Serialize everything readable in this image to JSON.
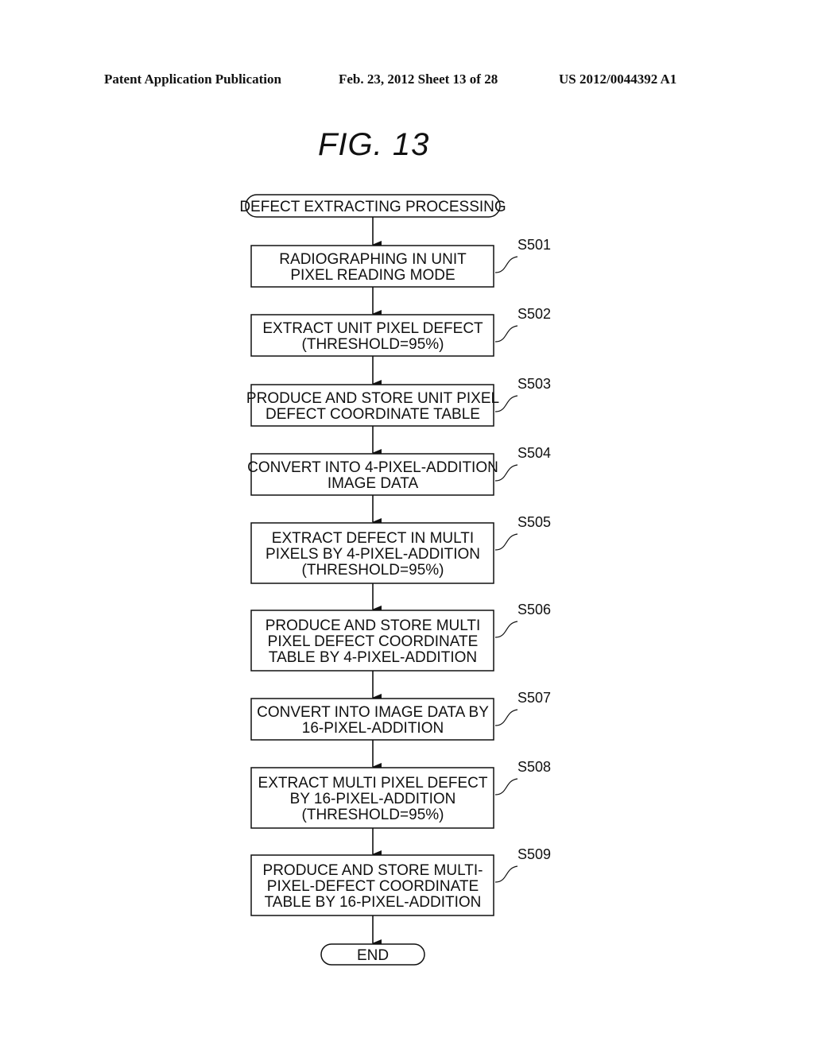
{
  "header": {
    "left": "Patent Application Publication",
    "middle": "Feb. 23, 2012   Sheet 13 of 28",
    "right": "US 2012/0044392 A1"
  },
  "figure": {
    "title": "FIG.  13"
  },
  "flowchart": {
    "start": "DEFECT EXTRACTING PROCESSING",
    "end": "END",
    "steps": [
      {
        "id": "S501",
        "lines": [
          "RADIOGRAPHING IN UNIT",
          "PIXEL READING MODE"
        ]
      },
      {
        "id": "S502",
        "lines": [
          "EXTRACT UNIT PIXEL DEFECT",
          "(THRESHOLD=95%)"
        ]
      },
      {
        "id": "S503",
        "lines": [
          "PRODUCE AND STORE UNIT PIXEL",
          "DEFECT COORDINATE TABLE"
        ]
      },
      {
        "id": "S504",
        "lines": [
          "CONVERT INTO 4-PIXEL-ADDITION",
          "IMAGE DATA"
        ]
      },
      {
        "id": "S505",
        "lines": [
          "EXTRACT DEFECT IN MULTI",
          "PIXELS BY 4-PIXEL-ADDITION",
          "(THRESHOLD=95%)"
        ]
      },
      {
        "id": "S506",
        "lines": [
          "PRODUCE AND STORE MULTI",
          "PIXEL DEFECT COORDINATE",
          "TABLE BY 4-PIXEL-ADDITION"
        ]
      },
      {
        "id": "S507",
        "lines": [
          "CONVERT INTO IMAGE DATA BY",
          "16-PIXEL-ADDITION"
        ]
      },
      {
        "id": "S508",
        "lines": [
          "EXTRACT MULTI PIXEL DEFECT",
          "BY 16-PIXEL-ADDITION",
          "(THRESHOLD=95%)"
        ]
      },
      {
        "id": "S509",
        "lines": [
          "PRODUCE AND STORE MULTI-",
          "PIXEL-DEFECT COORDINATE",
          "TABLE BY 16-PIXEL-ADDITION"
        ]
      }
    ]
  }
}
